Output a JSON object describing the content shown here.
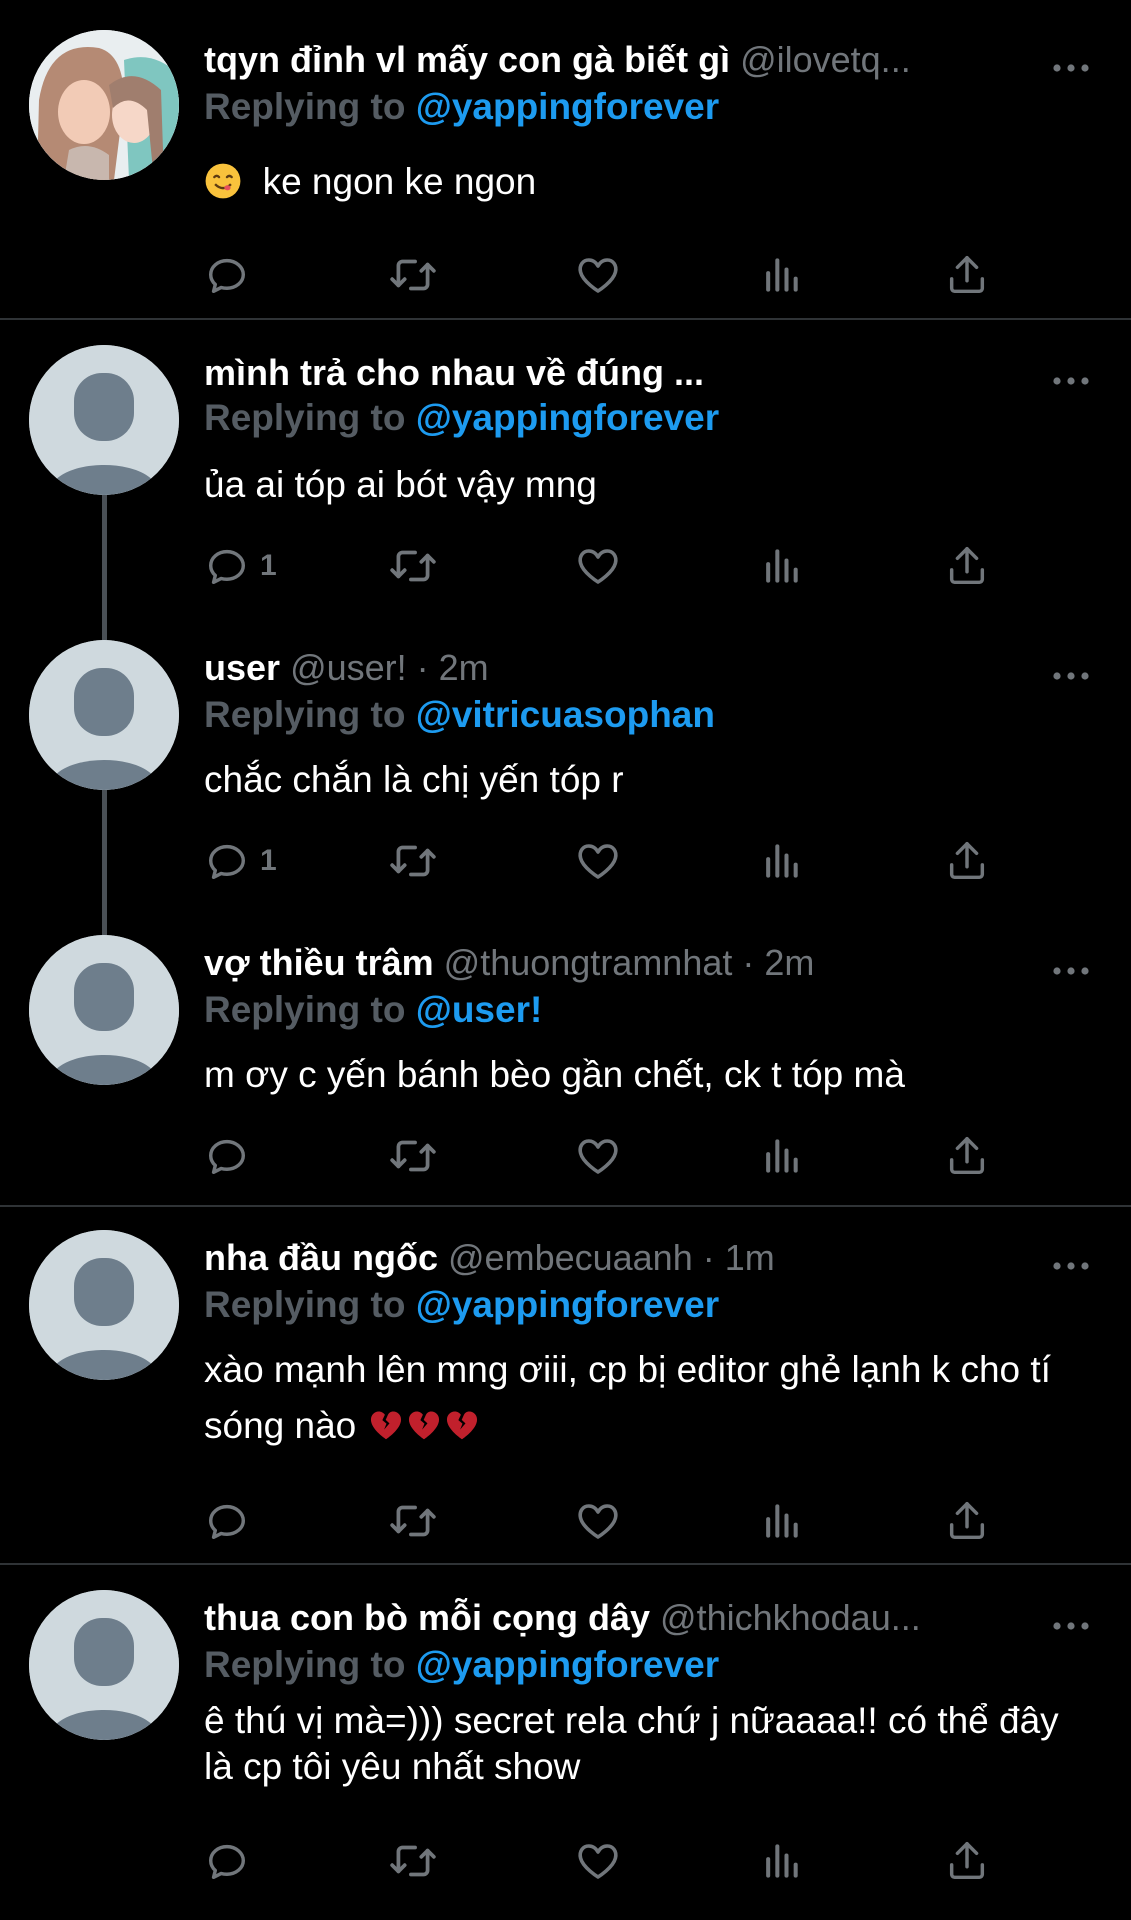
{
  "tweets": [
    {
      "name": "tqyn đỉnh vl mấy con gà biết gì",
      "handle": "@ilovetq...",
      "time": "",
      "replying_prefix": "Replying to",
      "replying_to": "@yappingforever",
      "body": "ke ngon ke ngon",
      "reply_count": ""
    },
    {
      "name": "mình trả cho nhau về đúng ...",
      "handle": "",
      "time": "",
      "replying_prefix": "Replying to",
      "replying_to": "@yappingforever",
      "body": "ủa ai tóp ai bót vậy mng",
      "reply_count": "1"
    },
    {
      "name": "user",
      "handle": "@user! · 2m",
      "time": "",
      "replying_prefix": "Replying to",
      "replying_to": "@vitricuasophan",
      "body": "chắc chắn là chị yến tóp r",
      "reply_count": "1"
    },
    {
      "name": "vợ thiều trâm",
      "handle": "@thuongtramnhat · 2m",
      "time": "",
      "replying_prefix": "Replying to",
      "replying_to": "@user!",
      "body": "m ơy c yến bánh bèo gần chết, ck t tóp mà",
      "reply_count": ""
    },
    {
      "name": "nha đầu ngốc",
      "handle": "@embecuaanh · 1m",
      "time": "",
      "replying_prefix": "Replying to",
      "replying_to": "@yappingforever",
      "body": "xào mạnh lên mng ơiii, cp bị editor ghẻ lạnh k cho tí sóng nào",
      "reply_count": ""
    },
    {
      "name": "thua con bò mỗi cọng dây",
      "handle": "@thichkhodau...",
      "time": "",
      "replying_prefix": "Replying to",
      "replying_to": "@yappingforever",
      "body": "ê thú vị mà=))) secret rela chứ j nữaaaa!! có thể đây là cp tôi yêu nhất show",
      "reply_count": ""
    }
  ],
  "icons": {
    "more": "more-icon",
    "reply": "reply-icon",
    "retweet": "retweet-icon",
    "like": "heart-icon",
    "views": "views-icon",
    "share": "share-icon",
    "emoji_face": "yum-face-emoji",
    "emoji_heart": "broken-heart-emoji"
  },
  "colors": {
    "background": "#000000",
    "mention": "#1d9bf0",
    "muted": "#71767b",
    "divider": "#2f3336"
  }
}
